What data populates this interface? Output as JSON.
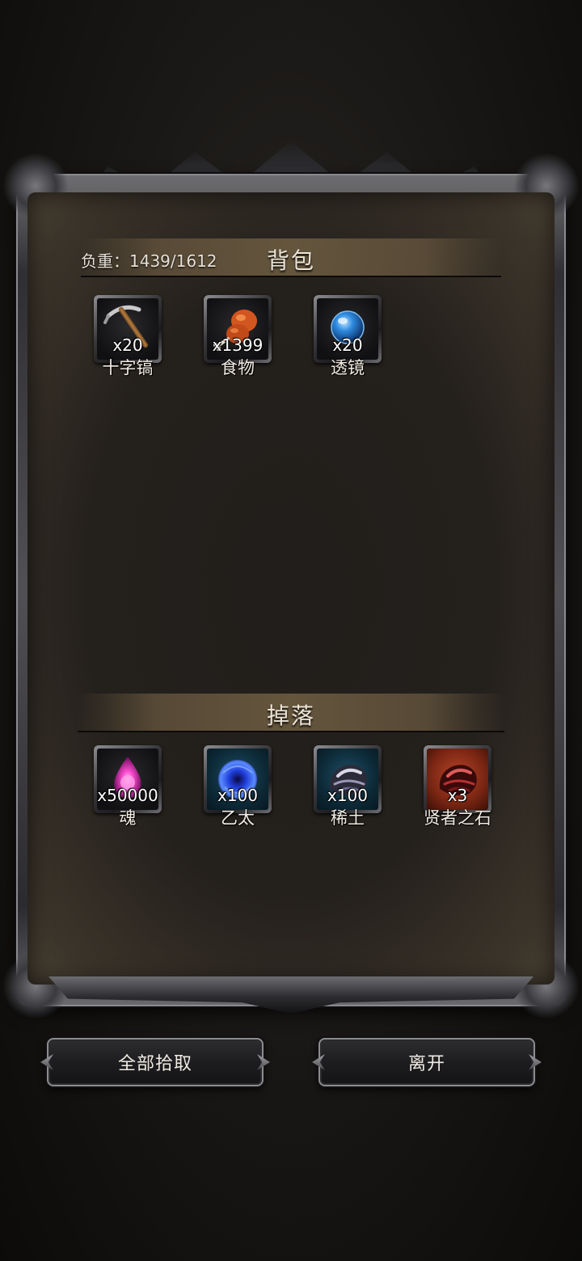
{
  "backpack": {
    "weight_text": "负重：1439/1612",
    "title": "背包",
    "items": [
      {
        "name": "十字镐",
        "count": "x20",
        "icon": "pickaxe-icon"
      },
      {
        "name": "食物",
        "count": "x1399",
        "icon": "drumstick-icon"
      },
      {
        "name": "透镜",
        "count": "x20",
        "icon": "lens-orb-icon"
      }
    ]
  },
  "drops": {
    "title": "掉落",
    "items": [
      {
        "name": "魂",
        "count": "x50000",
        "icon": "soul-flame-icon"
      },
      {
        "name": "乙太",
        "count": "x100",
        "icon": "ether-orb-icon"
      },
      {
        "name": "稀土",
        "count": "x100",
        "icon": "rare-earth-ore-icon"
      },
      {
        "name": "贤者之石",
        "count": "x3",
        "icon": "philosopher-stone-icon"
      }
    ]
  },
  "buttons": {
    "pickup_all": "全部拾取",
    "leave": "离开"
  },
  "colors": {
    "panel_bg": "#24201c",
    "frame_metal": "#505055",
    "header_band": "#68583f",
    "rare_slot": "#1f4f66",
    "epic_slot": "#b8452a"
  }
}
